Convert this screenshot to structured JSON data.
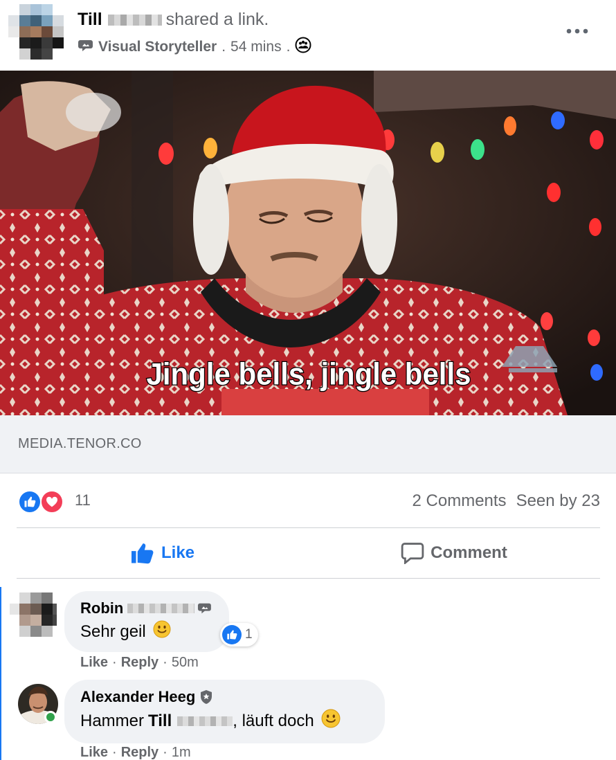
{
  "post": {
    "author_first_name": "Till",
    "action_text": "shared a link.",
    "group_name": "Visual Storyteller",
    "separator": ".",
    "time": "54 mins",
    "more_label": "•••"
  },
  "media": {
    "caption": "Jingle bells, jingle bells",
    "link_domain": "MEDIA.TENOR.CO"
  },
  "stats": {
    "reaction_count": "11",
    "comments": "2 Comments",
    "seen_by": "Seen by 23"
  },
  "actions": {
    "like_label": "Like",
    "comment_label": "Comment"
  },
  "comments": [
    {
      "author": "Robin",
      "text": "Sehr geil",
      "reaction_count": "1",
      "like_label": "Like",
      "reply_label": "Reply",
      "time": "50m"
    },
    {
      "author": "Alexander Heeg",
      "text_prefix": "Hammer",
      "mention": "Till",
      "text_suffix": ", läuft doch",
      "like_label": "Like",
      "reply_label": "Reply",
      "time": "1m"
    }
  ],
  "meta_separator": "·",
  "colors": {
    "accent": "#1877f2",
    "love": "#f33e58",
    "secondary_text": "#65676b",
    "bubble": "#f0f2f5",
    "online": "#31a24c"
  }
}
